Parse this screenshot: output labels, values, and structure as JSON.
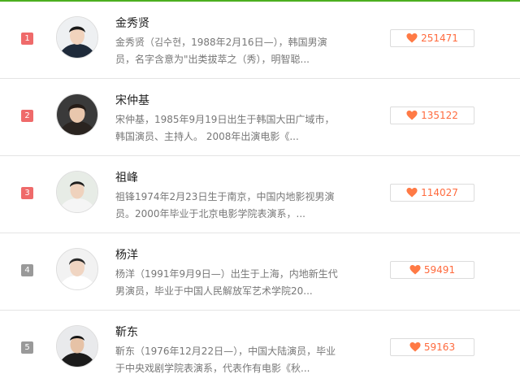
{
  "colors": {
    "top_line": "#4caf1f",
    "rank_top": "#ef6a6a",
    "rank_other": "#999999",
    "heart": "#ff7a45"
  },
  "items": [
    {
      "rank": "1",
      "name": "金秀贤",
      "desc_line1": "金秀贤（김수현，1988年2月16日—），韩国男演",
      "desc_line2": "员，名字含意为\"出类拔萃之（秀），明智聪...",
      "votes": "251471",
      "rank_color": "#ef6a6a"
    },
    {
      "rank": "2",
      "name": "宋仲基",
      "desc_line1": "宋仲基，1985年9月19日出生于韩国大田广域市，",
      "desc_line2": "韩国演员、主持人。 2008年出演电影《...",
      "votes": "135122",
      "rank_color": "#ef6a6a"
    },
    {
      "rank": "3",
      "name": "祖峰",
      "desc_line1": "祖锋1974年2月23日生于南京，中国内地影视男演",
      "desc_line2": "员。2000年毕业于北京电影学院表演系，...",
      "votes": "114027",
      "rank_color": "#ef6a6a"
    },
    {
      "rank": "4",
      "name": "杨洋",
      "desc_line1": "杨洋（1991年9月9日—）出生于上海，内地新生代",
      "desc_line2": "男演员，毕业于中国人民解放军艺术学院20...",
      "votes": "59491",
      "rank_color": "#999999"
    },
    {
      "rank": "5",
      "name": "靳东",
      "desc_line1": "靳东（1976年12月22日—），中国大陆演员，毕业",
      "desc_line2": "于中央戏剧学院表演系，代表作有电影《秋...",
      "votes": "59163",
      "rank_color": "#999999"
    }
  ]
}
